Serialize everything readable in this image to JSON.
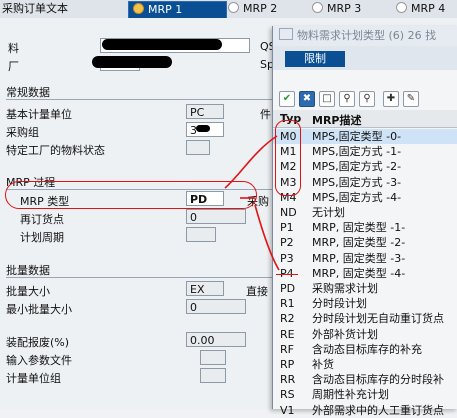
{
  "tabs": [
    {
      "label": "采购订单文本"
    },
    {
      "label": "MRP 1"
    },
    {
      "label": "MRP 2"
    },
    {
      "label": "MRP 3"
    },
    {
      "label": "MRP 4"
    }
  ],
  "header": {
    "material_label": "料",
    "plant_label": "厂",
    "qs_label": "QS",
    "sp_label": "Sp"
  },
  "general_data": {
    "section_title": "常规数据",
    "base_uom_label": "基本计量单位",
    "base_uom_value": "PC",
    "piece_label": "件",
    "purchasing_group_label": "采购组",
    "purchasing_group_value": "3",
    "plant_status_label": "特定工厂的物料状态"
  },
  "mrp_procedure": {
    "section_title": "MRP 过程",
    "mrp_type_label": "MRP 类型",
    "mrp_type_value": "PD",
    "purch_label": "采购",
    "reorder_point_label": "再订货点",
    "reorder_point_value": "0",
    "planning_cycle_label": "计划周期"
  },
  "lot_size": {
    "section_title": "批量数据",
    "lot_size_label": "批量大小",
    "lot_size_value": "EX",
    "direct_label": "直接",
    "min_lot_label": "最小批量大小",
    "min_lot_value": "0"
  },
  "extra": {
    "assembly_scrap_label": "装配报废(%)",
    "assembly_scrap_value": "0.00",
    "input_param_label": "输入参数文件",
    "unit_group_label": "计量单位组"
  },
  "popup": {
    "title": "物料需求计划类型 (6)  26 找",
    "tab_label": "限制",
    "col_type": "Typ",
    "col_desc": "MRP描述",
    "rows": [
      {
        "code": "M0",
        "desc": "MPS,固定类型 -0-",
        "selected": true
      },
      {
        "code": "M1",
        "desc": "MPS,固定方式 -1-"
      },
      {
        "code": "M2",
        "desc": "MPS,固定方式 -2-"
      },
      {
        "code": "M3",
        "desc": "MPS,固定方式 -3-"
      },
      {
        "code": "M4",
        "desc": "MPS,固定方式 -4-"
      },
      {
        "code": "ND",
        "desc": "无计划"
      },
      {
        "code": "P1",
        "desc": "MRP, 固定类型 -1-"
      },
      {
        "code": "P2",
        "desc": "MRP, 固定类型 -2-"
      },
      {
        "code": "P3",
        "desc": "MRP, 固定类型 -3-"
      },
      {
        "code": "P4",
        "desc": "MRP, 固定类型 -4-"
      },
      {
        "code": "PD",
        "desc": "采购需求计划"
      },
      {
        "code": "R1",
        "desc": "分时段计划"
      },
      {
        "code": "R2",
        "desc": "分时段计划无自动重订货点"
      },
      {
        "code": "RE",
        "desc": "外部补货计划"
      },
      {
        "code": "RF",
        "desc": "含动态目标库存的补充"
      },
      {
        "code": "RP",
        "desc": "补货"
      },
      {
        "code": "RR",
        "desc": "含动态目标库存的分时段补"
      },
      {
        "code": "RS",
        "desc": "周期性补充计划"
      },
      {
        "code": "V1",
        "desc": "外部需求中的人工重订货点"
      }
    ]
  },
  "colors": {
    "tab_active": "#0a4f94",
    "annotation": "#e01313",
    "selected_row": "#cfe3f7"
  }
}
